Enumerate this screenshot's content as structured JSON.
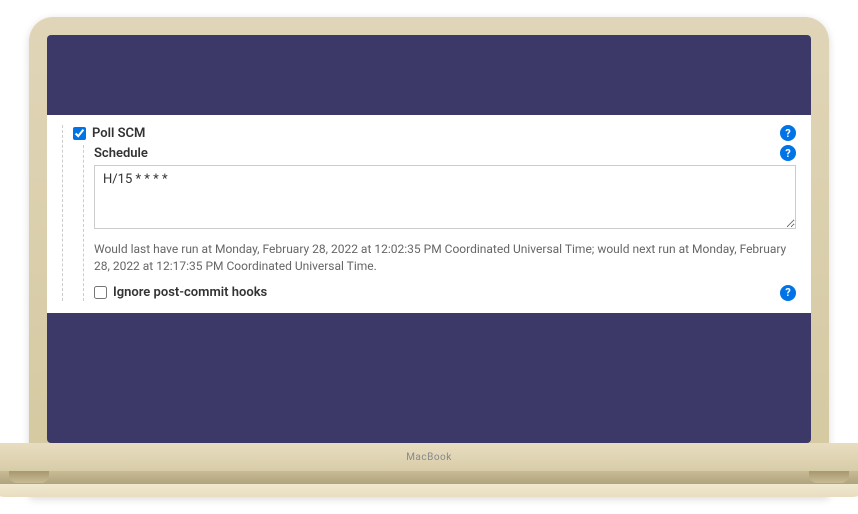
{
  "device": {
    "brand": "MacBook"
  },
  "form": {
    "poll_scm": {
      "label": "Poll SCM",
      "checked": true
    },
    "schedule": {
      "label": "Schedule",
      "value": "H/15 * * * *"
    },
    "info_text": "Would last have run at Monday, February 28, 2022 at 12:02:35 PM Coordinated Universal Time; would next run at Monday, February 28, 2022 at 12:17:35 PM Coordinated Universal Time.",
    "ignore_hooks": {
      "label": "Ignore post-commit hooks",
      "checked": false
    },
    "help_glyph": "?"
  }
}
